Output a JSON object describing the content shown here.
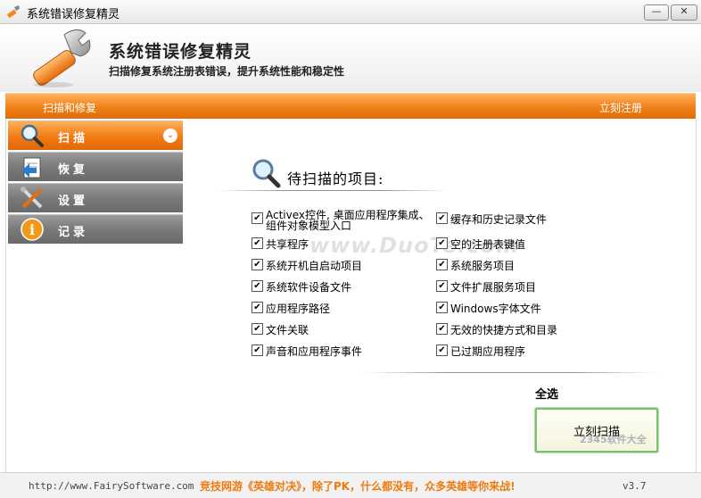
{
  "window": {
    "title": "系统错误修复精灵",
    "minimize_label": "—",
    "close_label": "✕"
  },
  "header": {
    "title": "系统错误修复精灵",
    "subtitle": "扫描修复系统注册表错误，提升系统性能和稳定性"
  },
  "orange_bar": {
    "left_label": "扫描和修复",
    "right_label": "立刻注册"
  },
  "sidebar": {
    "items": [
      {
        "label": "扫描",
        "icon": "magnifier-icon",
        "active": true
      },
      {
        "label": "恢复",
        "icon": "restore-icon",
        "active": false
      },
      {
        "label": "设置",
        "icon": "tools-icon",
        "active": false
      },
      {
        "label": "记录",
        "icon": "info-icon",
        "active": false
      }
    ],
    "chevron": "⌄"
  },
  "main": {
    "section_title": "待扫描的项目:",
    "items_left": [
      {
        "label": "Activex控件, 桌面应用程序集成、组件对象模型入口",
        "checked": true
      },
      {
        "label": "共享程序",
        "checked": true
      },
      {
        "label": "系统开机自启动项目",
        "checked": true
      },
      {
        "label": "系统软件设备文件",
        "checked": true
      },
      {
        "label": "应用程序路径",
        "checked": true
      },
      {
        "label": "文件关联",
        "checked": true
      },
      {
        "label": "声音和应用程序事件",
        "checked": true
      }
    ],
    "items_right": [
      {
        "label": "缓存和历史记录文件",
        "checked": true
      },
      {
        "label": "空的注册表键值",
        "checked": true
      },
      {
        "label": "系统服务项目",
        "checked": true
      },
      {
        "label": "文件扩展服务项目",
        "checked": true
      },
      {
        "label": "Windows字体文件",
        "checked": true
      },
      {
        "label": "无效的快捷方式和目录",
        "checked": true
      },
      {
        "label": "已过期应用程序",
        "checked": true
      }
    ],
    "check_mark": "✔",
    "watermark": "www.DuoTe.com",
    "select_all": "全选",
    "scan_button": "立刻扫描"
  },
  "status_bar": {
    "url": "http://www.FairySoftware.com",
    "ad": "竞技网游《英雄对决》，除了PK，什么都没有，众多英雄等你来战!",
    "version": "v3.7"
  },
  "corner_watermark": "2345软件大全",
  "colors": {
    "accent_orange": "#f08018",
    "nav_gray": "#7a7a7a",
    "scan_button_border": "#7cc06c"
  }
}
